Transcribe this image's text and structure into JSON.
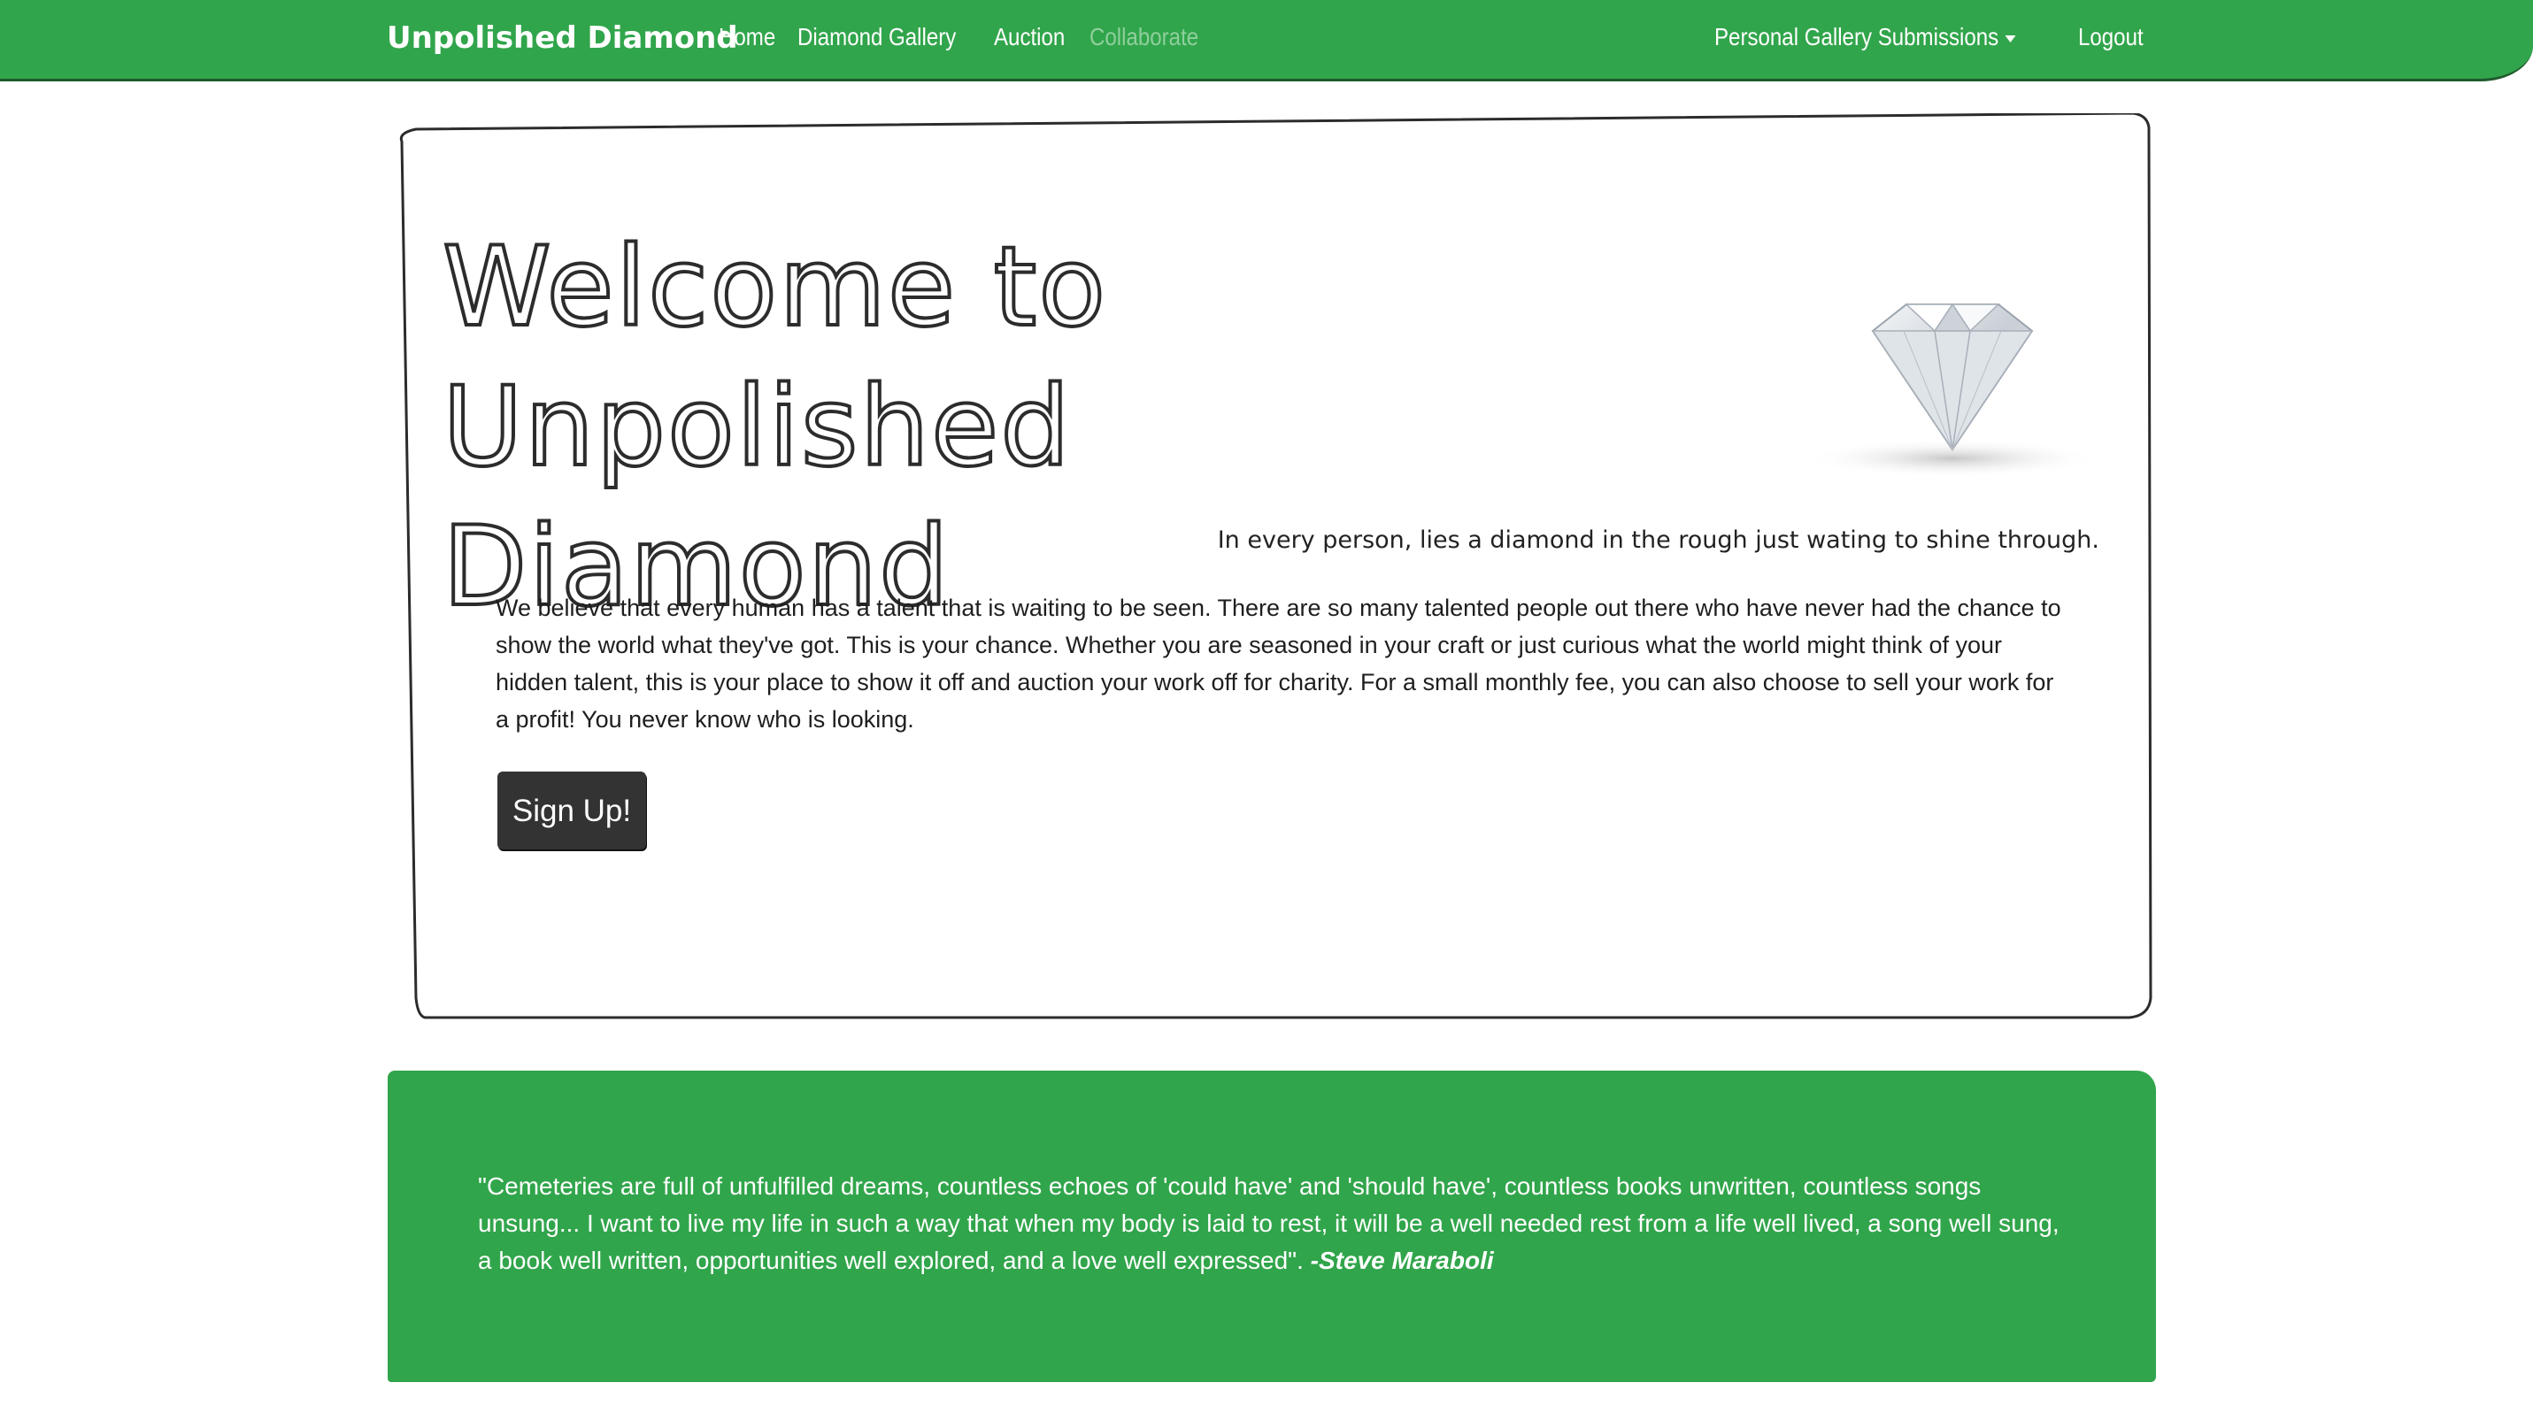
{
  "navbar": {
    "brand": "Unpolished Diamond",
    "links": [
      {
        "label": "Home"
      },
      {
        "label": "Diamond Gallery"
      },
      {
        "label": "Auction"
      },
      {
        "label": "Collaborate"
      }
    ],
    "right": {
      "dropdown_label": "Personal Gallery Submissions",
      "logout_label": "Logout"
    }
  },
  "hero": {
    "title_line1": "Welcome to Unpolished",
    "title_line2": "Diamond",
    "image_icon": "diamond-icon",
    "tagline": "In every person, lies a diamond in the rough just wating to shine through.",
    "lead": "We believe that every human has a talent that is waiting to be seen. There are so many talented people out there who have never had the chance to show the world what they've got. This is your chance. Whether you are seasoned in your craft or just curious what the world might think of your hidden talent, this is your place to show it off and auction your work off for charity. For a small monthly fee, you can also choose to sell your work for a profit! You never know who is looking.",
    "signup_label": "Sign Up!"
  },
  "quote": {
    "text": "\"Cemeteries are full of unfulfilled dreams, countless echoes of 'could have' and 'should have', countless books unwritten, countless songs unsung... I want to live my life in such a way that when my body is laid to rest, it will be a well needed rest from a life well lived, a song well sung, a book well written, opportunities well explored, and a love well expressed\".",
    "author": "-Steve Maraboli"
  },
  "colors": {
    "accent": "#31a54b",
    "dark": "#333333",
    "outline": "#2c2c2c"
  }
}
